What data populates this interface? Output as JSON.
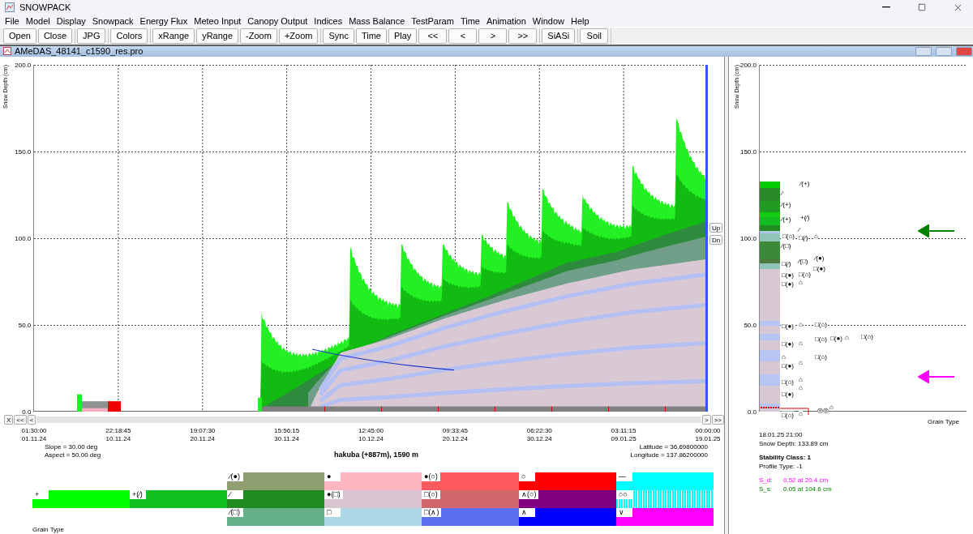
{
  "window": {
    "title": "SNOWPACK"
  },
  "menu": [
    "File",
    "Model",
    "Display",
    "Snowpack",
    "Energy Flux",
    "Meteo Input",
    "Canopy Output",
    "Indices",
    "Mass Balance",
    "TestParam",
    "Time",
    "Animation",
    "Window",
    "Help"
  ],
  "toolbar": [
    {
      "buttons": [
        "Open",
        "Close"
      ]
    },
    {
      "buttons": [
        "JPG"
      ]
    },
    {
      "buttons": [
        "Colors"
      ]
    },
    {
      "buttons": [
        "xRange",
        "yRange",
        "-Zoom",
        "+Zoom"
      ]
    },
    {
      "buttons": [
        "Sync",
        "Time",
        "Play",
        "<<",
        "<",
        ">",
        ">>"
      ]
    },
    {
      "buttons": [
        "SiASi"
      ]
    },
    {
      "buttons": [
        "Soil"
      ]
    }
  ],
  "document": {
    "title": "AMeDAS_48141_c1590_res.pro"
  },
  "timeline": {
    "y_label": "Snow Depth (cm)",
    "y_ticks": [
      "200.0",
      "150.0",
      "100.0",
      "50.0",
      "0.0"
    ],
    "x_ticks": [
      {
        "time": "01:30:00",
        "date": "01.11.24"
      },
      {
        "time": "22:18:45",
        "date": "10.11.24"
      },
      {
        "time": "19:07:30",
        "date": "20.11.24"
      },
      {
        "time": "15:56:15",
        "date": "30.11.24"
      },
      {
        "time": "12:45:00",
        "date": "10.12.24"
      },
      {
        "time": "09:33:45",
        "date": "20.12.24"
      },
      {
        "time": "06:22:30",
        "date": "30.12.24"
      },
      {
        "time": "03:11:15",
        "date": "09.01.25"
      },
      {
        "time": "00:00:00",
        "date": "19.01.25"
      }
    ],
    "scroll_left": [
      "X",
      "<<",
      "<"
    ],
    "scroll_right": [
      ">",
      ">>"
    ],
    "zoom_buttons": [
      "Up",
      "Dn"
    ],
    "slope": "Slope = 30.00 deg",
    "aspect": "Aspect = 50.00 deg",
    "station": "hakuba (+887m), 1590 m",
    "latitude": "Latitude = 36.69800000",
    "longitude": "Longitude = 137.86200000"
  },
  "legend": {
    "title": "Grain Type",
    "columns": [
      {
        "cells": [
          {
            "kind": "empty"
          },
          {
            "kind": "solid",
            "symbol": "+",
            "color": "#00ff00"
          },
          {
            "kind": "empty"
          }
        ]
      },
      {
        "cells": [
          {
            "kind": "empty"
          },
          {
            "kind": "solid",
            "symbol": "+(⁄)",
            "color": "#11c11f"
          },
          {
            "kind": "empty"
          }
        ]
      },
      {
        "cells": [
          {
            "kind": "solid",
            "symbol": "⁄(●)",
            "color": "#8f9f6f"
          },
          {
            "kind": "solid",
            "symbol": "⁄",
            "color": "#228b22"
          },
          {
            "kind": "solid",
            "symbol": "⁄(□)",
            "color": "#66b088"
          }
        ]
      },
      {
        "cells": [
          {
            "kind": "solid",
            "symbol": "●",
            "color": "#ffb6c1"
          },
          {
            "kind": "solid",
            "symbol": "●(□)",
            "color": "#d8c4d0"
          },
          {
            "kind": "solid",
            "symbol": "□",
            "color": "#add8e6"
          }
        ]
      },
      {
        "cells": [
          {
            "kind": "solid",
            "symbol": "●(○)",
            "color": "#ff5a5f"
          },
          {
            "kind": "solid",
            "symbol": "□(○)",
            "color": "#d0686c"
          },
          {
            "kind": "solid",
            "symbol": "□(∧)",
            "color": "#5a6ef0"
          }
        ]
      },
      {
        "cells": [
          {
            "kind": "solid",
            "symbol": "○",
            "color": "#ff0000"
          },
          {
            "kind": "solid",
            "symbol": "∧(○)",
            "color": "#800080"
          },
          {
            "kind": "solid",
            "symbol": "∧",
            "color": "#0000ff"
          }
        ]
      },
      {
        "cells": [
          {
            "kind": "solid",
            "symbol": "—",
            "color": "#00ffff"
          },
          {
            "kind": "striped",
            "symbol": "○○",
            "color": "#00ffff"
          },
          {
            "kind": "solid",
            "symbol": "∨",
            "color": "#ff00ff"
          }
        ]
      }
    ]
  },
  "profile": {
    "y_label": "Snow Depth (cm)",
    "y_ticks": [
      "200.0",
      "150.0",
      "100.0",
      "50.0",
      "0.0"
    ],
    "layer_labels": [
      {
        "text": "⁄(+)"
      },
      {
        "text": "⁄"
      },
      {
        "text": "⁄(+)"
      },
      {
        "text": "⁄(+)"
      },
      {
        "text": "+(⁄)"
      },
      {
        "text": "⁄"
      },
      {
        "text": "□(⌂)"
      },
      {
        "text": "□(⁄)"
      },
      {
        "text": "⌂"
      },
      {
        "text": "⁄(□)"
      },
      {
        "text": "⁄(●)"
      },
      {
        "text": "⁄(□)"
      },
      {
        "text": "□(⁄)"
      },
      {
        "text": "□(●)"
      },
      {
        "text": "□(●)"
      },
      {
        "text": "□(⌂)"
      },
      {
        "text": "□(●)"
      },
      {
        "text": "⌂"
      },
      {
        "text": "□(●)"
      },
      {
        "text": "⌂"
      },
      {
        "text": "□(⌂)"
      },
      {
        "text": "□(⌂)"
      },
      {
        "text": "□(●)"
      },
      {
        "text": "⌂"
      },
      {
        "text": "□(⌂)"
      },
      {
        "text": "□(●)"
      },
      {
        "text": "⌂"
      },
      {
        "text": "⌂"
      },
      {
        "text": "□(⌂)"
      },
      {
        "text": "□(●)"
      },
      {
        "text": "⌂"
      },
      {
        "text": "□(⌂)"
      },
      {
        "text": "⌂"
      },
      {
        "text": "⌂"
      },
      {
        "text": "□(●)"
      },
      {
        "text": "⌂"
      },
      {
        "text": "◎◎"
      },
      {
        "text": "□(⌂)"
      },
      {
        "text": "⌂"
      }
    ],
    "x_label": "Grain Type",
    "timestamp": "18.01.25 21:00",
    "snow_depth": "Snow Depth: 133.89 cm",
    "stability_class": "Stability Class: 1",
    "profile_type": "Profile Type: -1",
    "indices": [
      {
        "name": "S_d:",
        "value": "0.52 at 20.4 cm",
        "color": "#ff00ff"
      },
      {
        "name": "S_s:",
        "value": "0.05 at 104.6 cm",
        "color": "#008000"
      }
    ]
  }
}
